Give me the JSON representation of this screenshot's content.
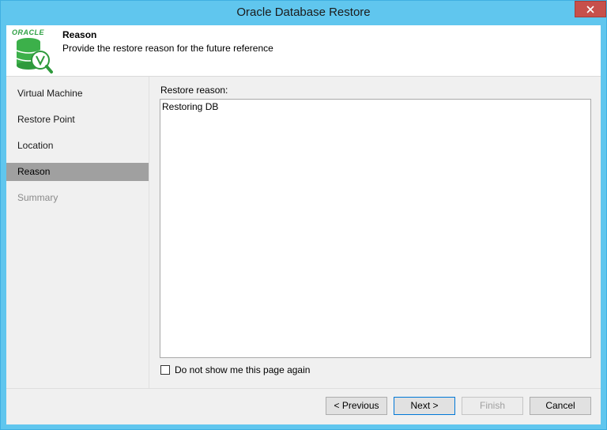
{
  "window": {
    "title": "Oracle Database Restore"
  },
  "header": {
    "logo_text": "ORACLE",
    "title": "Reason",
    "subtitle": "Provide the restore reason for the future reference"
  },
  "sidebar": {
    "items": [
      {
        "label": "Virtual Machine",
        "state": "normal"
      },
      {
        "label": "Restore Point",
        "state": "normal"
      },
      {
        "label": "Location",
        "state": "normal"
      },
      {
        "label": "Reason",
        "state": "active"
      },
      {
        "label": "Summary",
        "state": "disabled"
      }
    ]
  },
  "main": {
    "reason_label": "Restore reason:",
    "reason_value": "Restoring DB",
    "checkbox_label": "Do not show me this page again",
    "checkbox_checked": false
  },
  "footer": {
    "previous": "< Previous",
    "next": "Next >",
    "finish": "Finish",
    "cancel": "Cancel"
  },
  "icons": {
    "close": "close-icon",
    "database": "database-icon"
  },
  "colors": {
    "titlebar": "#60c6ee",
    "close_button": "#c7504b",
    "active_step": "#a0a0a0",
    "logo_green": "#2ea043"
  }
}
